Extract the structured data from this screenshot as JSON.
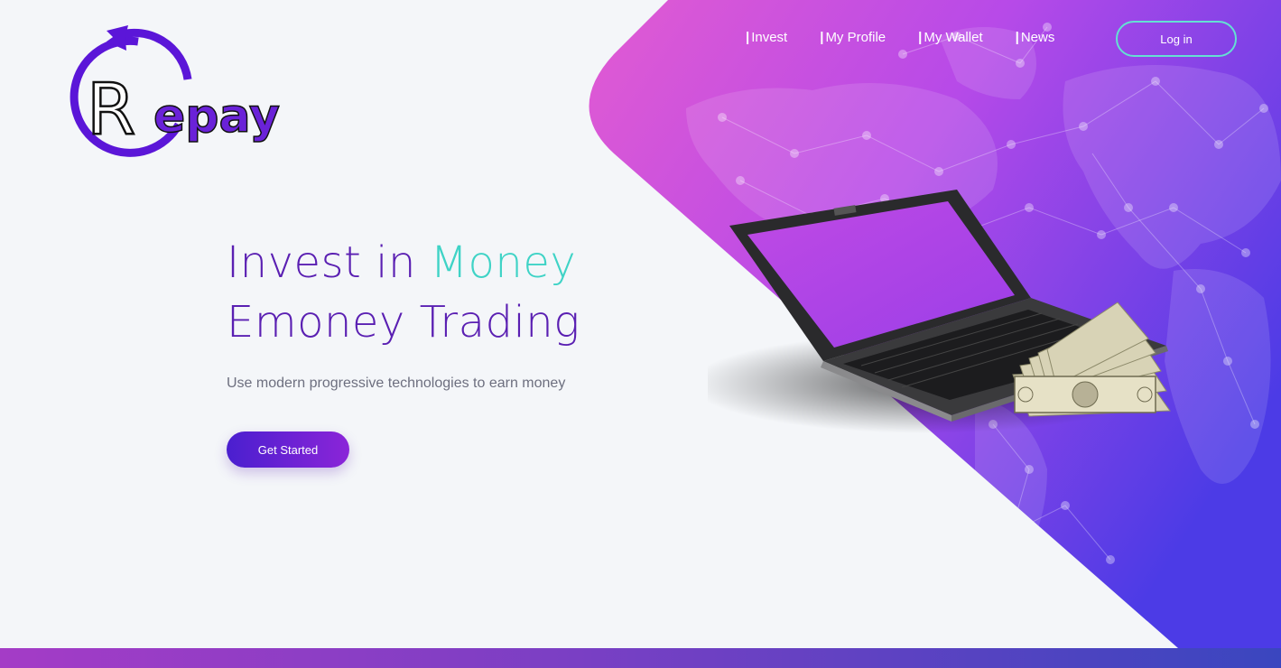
{
  "brand": {
    "logo_text": "Repay"
  },
  "nav": {
    "items": [
      {
        "label": "Invest"
      },
      {
        "label": "My Profile"
      },
      {
        "label": "My Wallet"
      },
      {
        "label": "News"
      }
    ],
    "login_label": "Log in"
  },
  "hero": {
    "line1_prefix": "Invest in ",
    "line1_accent": "Money",
    "line2": "Emoney Trading",
    "subtitle": "Use modern progressive technologies to earn money",
    "cta_label": "Get Started"
  },
  "colors": {
    "accent_teal": "#3fd3c6",
    "brand_purple": "#5a1fb2",
    "gradient_pink": "#e05ad8",
    "gradient_blue": "#4b3fe6"
  },
  "icons": [
    "repay-logo-icon",
    "laptop-illustration",
    "world-map-graphic",
    "cash-stack-illustration"
  ]
}
